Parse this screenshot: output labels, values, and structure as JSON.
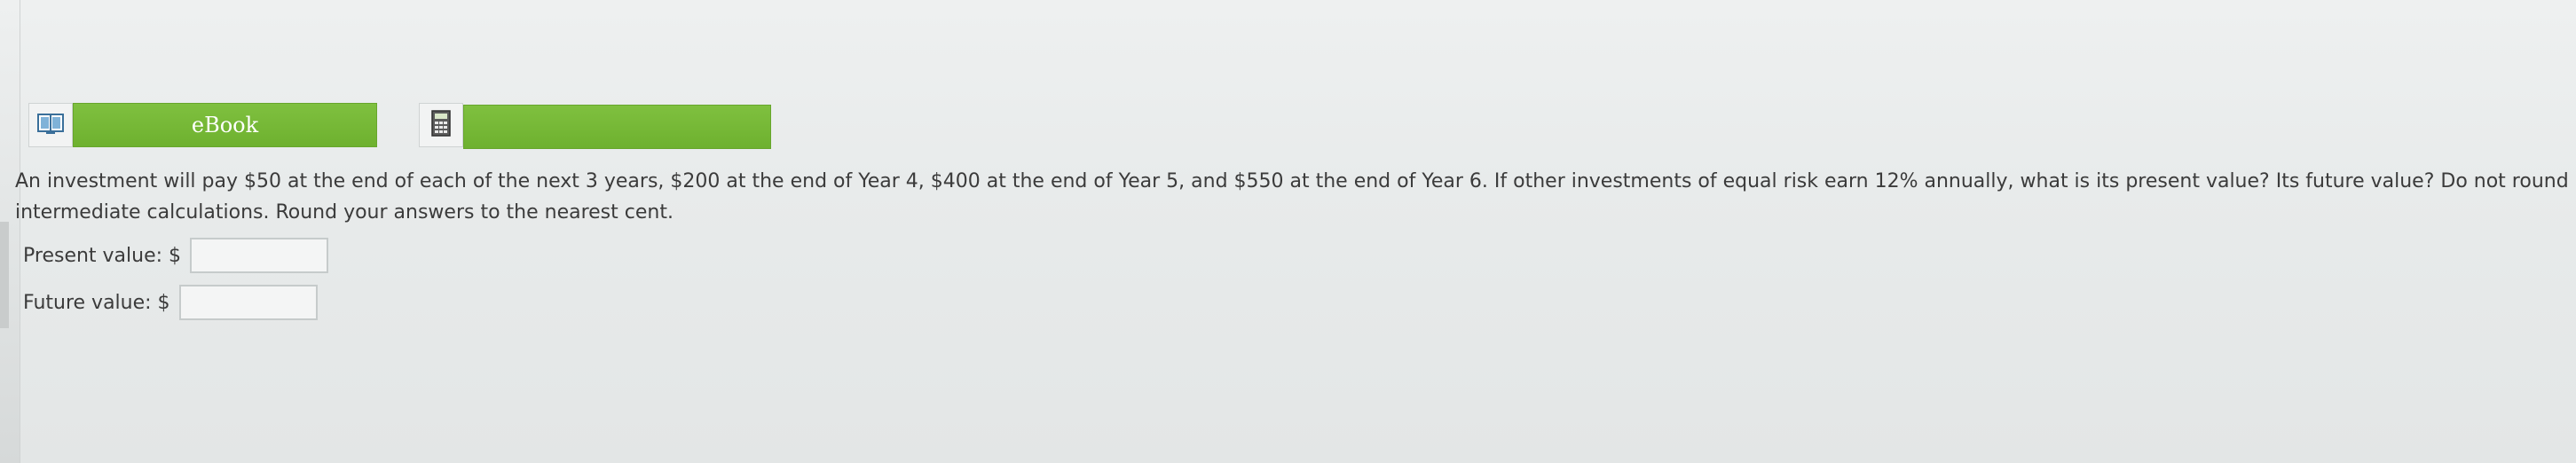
{
  "toolbar": {
    "ebook_label": "eBook",
    "book_icon": "book-open-icon",
    "calculator_icon": "calculator-icon"
  },
  "question": {
    "line1": "An investment will pay $50 at the end of each of the next 3 years, $200 at the end of Year 4, $400 at the end of Year 5, and $550 at the end of Year 6. If other investments of equal risk earn 12% annually, what is its present value? Its future value? Do not round",
    "line2": "intermediate calculations. Round your answers to the nearest cent."
  },
  "answers": {
    "present_label": "Present value: $",
    "present_value": "",
    "future_label": "Future value: $",
    "future_value": ""
  },
  "colors": {
    "accent_green": "#72b534",
    "background": "#e9ecec"
  }
}
